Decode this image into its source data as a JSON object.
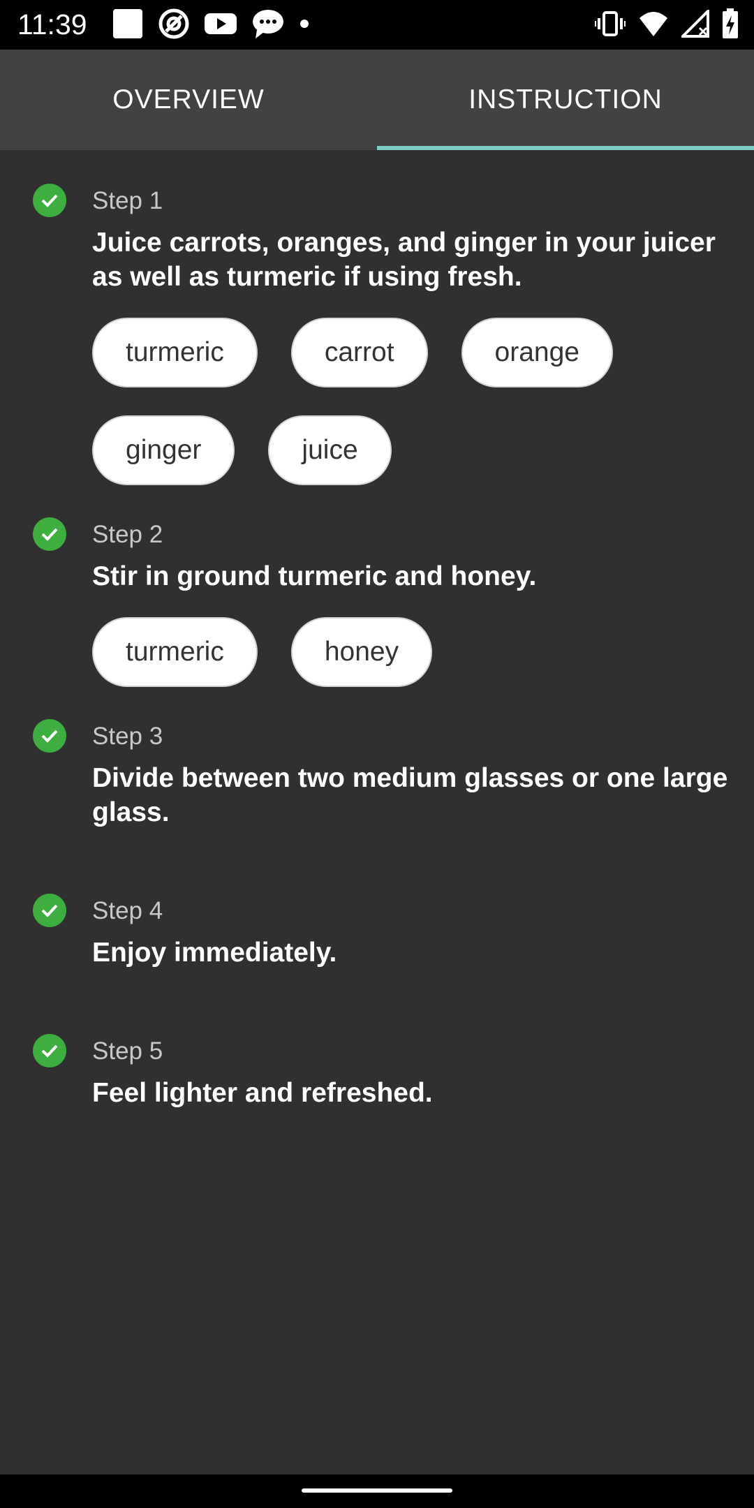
{
  "status_bar": {
    "time": "11:39",
    "icons_left": [
      "square-icon",
      "at-icon",
      "youtube-icon",
      "chat-icon",
      "dot-icon"
    ],
    "icons_right": [
      "vibrate-icon",
      "wifi-icon",
      "signal-icon",
      "battery-icon"
    ]
  },
  "tabs": [
    {
      "label": "OVERVIEW",
      "active": false
    },
    {
      "label": "INSTRUCTION",
      "active": true
    }
  ],
  "steps": [
    {
      "label": "Step 1",
      "text": "Juice carrots, oranges, and ginger in your juicer as well as turmeric if using fresh.",
      "chips": [
        "turmeric",
        "carrot",
        "orange",
        "ginger",
        "juice"
      ]
    },
    {
      "label": "Step 2",
      "text": "Stir in ground turmeric and honey.",
      "chips": [
        "turmeric",
        "honey"
      ]
    },
    {
      "label": "Step 3",
      "text": "Divide between two medium glasses or one large glass.",
      "chips": []
    },
    {
      "label": "Step 4",
      "text": "Enjoy immediately.",
      "chips": []
    },
    {
      "label": "Step 5",
      "text": "Feel lighter and refreshed.",
      "chips": []
    }
  ],
  "colors": {
    "background": "#303030",
    "tab_bar": "#424242",
    "tab_indicator": "#80cbc4",
    "check": "#3dae3f"
  }
}
